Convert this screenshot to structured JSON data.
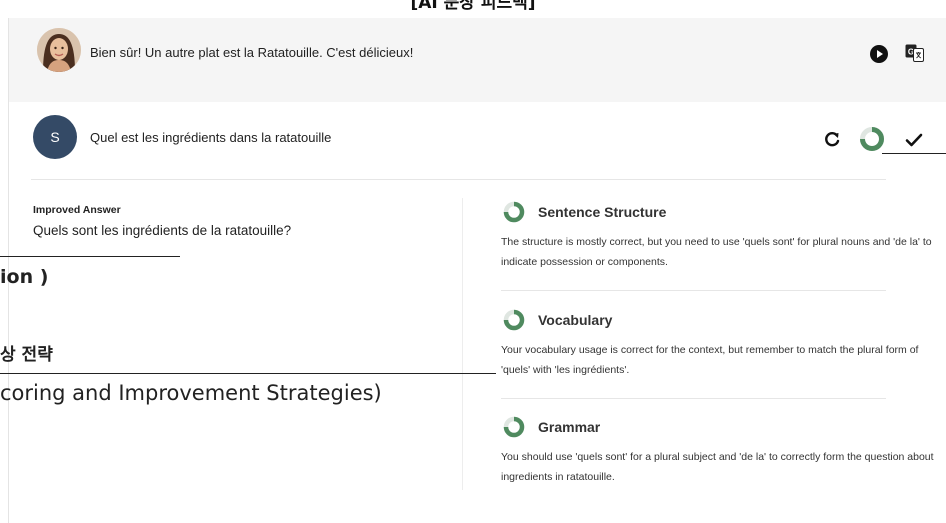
{
  "top_caption": "[AI 문장 피드백]",
  "ai_message": {
    "text": "Bien sûr! Un autre plat est la Ratatouille. C'est délicieux!"
  },
  "user_message": {
    "avatar_letter": "S",
    "text": "Quel est les ingrédients dans la ratatouille"
  },
  "improved": {
    "label": "Improved Answer",
    "text": "Quels sont les ingrédients de la ratatouille?"
  },
  "feedback": [
    {
      "title": "Sentence Structure",
      "text": "The structure is mostly correct, but you need to use 'quels sont' for plural nouns and 'de la' to indicate possession or components."
    },
    {
      "title": "Vocabulary",
      "text": "Your vocabulary usage is correct for the context, but remember to match the plural form of 'quels' with 'les ingrédients'."
    },
    {
      "title": "Grammar",
      "text": "You should use 'quels sont' for a plural subject and 'de la' to correctly form the question about ingredients in ratatouille."
    }
  ],
  "annotations": {
    "a1": "ion )",
    "a2": "상 전략",
    "a3": "coring and Improvement Strategies)"
  },
  "colors": {
    "ring_green": "#4f8a5f",
    "ring_track": "#dfe6e1",
    "user_avatar": "#344a66",
    "ai_row_bg": "#f5f5f5"
  }
}
